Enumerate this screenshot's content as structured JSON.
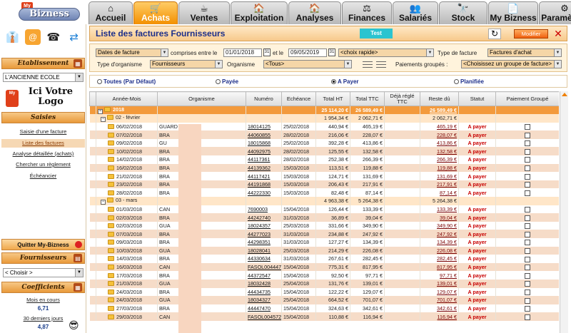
{
  "app": {
    "logo_small": "My",
    "logo": "Bizness"
  },
  "tabs": [
    {
      "label": "Accueil",
      "icon": "⌂"
    },
    {
      "label": "Achats",
      "icon": "🛒"
    },
    {
      "label": "Ventes",
      "icon": "☕"
    },
    {
      "label": "Exploitation",
      "icon": "🏠"
    },
    {
      "label": "Analyses",
      "icon": "🏠"
    },
    {
      "label": "Finances",
      "icon": "⚖"
    },
    {
      "label": "Salariés",
      "icon": "👥"
    },
    {
      "label": "Stock",
      "icon": "🔭"
    },
    {
      "label": "My Bizness",
      "icon": "📄"
    },
    {
      "label": "Paramètres",
      "icon": "⚙"
    }
  ],
  "sidebar": {
    "etablissement_header": "Etablissement",
    "etablissement_value": "L'ANCIENNE ECOLE",
    "logo_tag": "My",
    "logo_text": "Ici Votre Logo",
    "saisies_header": "Saisies",
    "links": [
      "Saisie d'une facture",
      "Liste des factures",
      "Analyse détaillée (achats)",
      "Chercher un règlement",
      "Échéancier"
    ],
    "quit_label": "Quitter My-Bizness",
    "fournisseurs_header": "Fournisseurs",
    "fournisseurs_value": "< Choisir >",
    "coefficients_header": "Coefficients",
    "mois_label": "Mois en cours",
    "mois_value": "6,71",
    "jours_label": "30 derniers jours",
    "jours_value": "4,87"
  },
  "page": {
    "title": "Liste des factures Fournisseurs",
    "test_label": "Test",
    "modifier_label": "Modifier"
  },
  "filters": {
    "date_type": "Dates de facture",
    "between_label": "comprises entre le",
    "date_from": "01/01/2018",
    "and_label": "et le",
    "date_to": "09/05/2019",
    "quick_choice": "<choix rapide>",
    "invoice_type_label": "Type de facture",
    "invoice_type": "Factures d'achat",
    "org_type_label": "Type d'organisme",
    "org_type": "Fournisseurs",
    "org_label": "Organisme",
    "org_value": "<Tous>",
    "grouped_label": "Paiements groupés :",
    "grouped_value": "<Choisissez un groupe de facture>"
  },
  "radios": [
    {
      "label": "Toutes (Par Défaut)",
      "checked": false
    },
    {
      "label": "Payée",
      "checked": false
    },
    {
      "label": "A Payer",
      "checked": true
    },
    {
      "label": "Planifiée",
      "checked": false
    }
  ],
  "table": {
    "headers": [
      "",
      "Année-Mois",
      "Organisme",
      "Numéro",
      "Echéance",
      "Total HT",
      "Total TTC",
      "Déjà réglé TTC",
      "Reste dû",
      "Statut",
      "Paiement Groupé"
    ],
    "year_row": {
      "label": "2018",
      "ht": "25 114,20 €",
      "ttc": "26 589,49 €",
      "reste": "26 589,49 €"
    },
    "rows": [
      {
        "kind": "month",
        "label": "02 - février",
        "ht": "1 954,34 €",
        "ttc": "2 062,71 €",
        "reste": "2 062,71 €"
      },
      {
        "kind": "inv",
        "date": "06/02/2018",
        "org": "GUARD",
        "num": "18014125",
        "due": "25/02/2018",
        "ht": "440,94 €",
        "ttc": "465,19 €",
        "reste": "465,19 €",
        "status": "A payer"
      },
      {
        "kind": "inv",
        "date": "07/02/2018",
        "org": "BRA",
        "num": "44060855",
        "due": "28/02/2018",
        "ht": "216,06 €",
        "ttc": "228,07 €",
        "reste": "228,07 €",
        "status": "A payer"
      },
      {
        "kind": "inv",
        "date": "09/02/2018",
        "org": "GU",
        "num": "18015868",
        "due": "25/02/2018",
        "ht": "392,28 €",
        "ttc": "413,86 €",
        "reste": "413,86 €",
        "status": "A payer"
      },
      {
        "kind": "inv",
        "date": "10/02/2018",
        "org": "BRA",
        "num": "44092975",
        "due": "28/02/2018",
        "ht": "125,55 €",
        "ttc": "132,58 €",
        "reste": "132,58 €",
        "status": "A payer"
      },
      {
        "kind": "inv",
        "date": "14/02/2018",
        "org": "BRA",
        "num": "44117361",
        "due": "28/02/2018",
        "ht": "252,38 €",
        "ttc": "266,39 €",
        "reste": "266,39 €",
        "status": "A payer"
      },
      {
        "kind": "inv",
        "date": "16/02/2018",
        "org": "BRA",
        "num": "44139362",
        "due": "15/03/2018",
        "ht": "113,51 €",
        "ttc": "119,88 €",
        "reste": "119,88 €",
        "status": "A payer"
      },
      {
        "kind": "inv",
        "date": "21/02/2018",
        "org": "BRA",
        "num": "44117421",
        "due": "15/03/2018",
        "ht": "124,71 €",
        "ttc": "131,69 €",
        "reste": "131,69 €",
        "status": "A payer"
      },
      {
        "kind": "inv",
        "date": "23/02/2018",
        "org": "BRA",
        "num": "44191868",
        "due": "15/03/2018",
        "ht": "206,43 €",
        "ttc": "217,91 €",
        "reste": "217,91 €",
        "status": "A payer"
      },
      {
        "kind": "inv",
        "date": "28/02/2018",
        "org": "BRA",
        "num": "44222330",
        "due": "15/03/2018",
        "ht": "82,48 €",
        "ttc": "87,14 €",
        "reste": "87,14 €",
        "status": "A payer"
      },
      {
        "kind": "month",
        "label": "03 - mars",
        "ht": "4 963,38 €",
        "ttc": "5 264,38 €",
        "reste": "5 264,38 €"
      },
      {
        "kind": "inv",
        "date": "01/03/2018",
        "org": "CAN",
        "num": "7690003",
        "due": "15/04/2018",
        "ht": "126,44 €",
        "ttc": "133,39 €",
        "reste": "133,39 €",
        "status": "A payer"
      },
      {
        "kind": "inv",
        "date": "02/03/2018",
        "org": "BRA",
        "num": "44242740",
        "due": "31/03/2018",
        "ht": "36,89 €",
        "ttc": "39,04 €",
        "reste": "39,04 €",
        "status": "A payer"
      },
      {
        "kind": "inv",
        "date": "02/03/2018",
        "org": "GUA",
        "num": "18024357",
        "due": "25/03/2018",
        "ht": "331,66 €",
        "ttc": "349,90 €",
        "reste": "349,90 €",
        "status": "A payer"
      },
      {
        "kind": "inv",
        "date": "07/03/2018",
        "org": "BRA",
        "num": "44277023",
        "due": "31/03/2018",
        "ht": "234,88 €",
        "ttc": "247,92 €",
        "reste": "247,92 €",
        "status": "A payer"
      },
      {
        "kind": "inv",
        "date": "09/03/2018",
        "org": "BRA",
        "num": "44298351",
        "due": "31/03/2018",
        "ht": "127,27 €",
        "ttc": "134,39 €",
        "reste": "134,39 €",
        "status": "A payer"
      },
      {
        "kind": "inv",
        "date": "10/03/2018",
        "org": "GUA",
        "num": "18028041",
        "due": "25/03/2018",
        "ht": "214,29 €",
        "ttc": "226,08 €",
        "reste": "226,08 €",
        "status": "A payer"
      },
      {
        "kind": "inv",
        "date": "14/03/2018",
        "org": "BRA",
        "num": "44330634",
        "due": "31/03/2018",
        "ht": "267,61 €",
        "ttc": "282,45 €",
        "reste": "282,45 €",
        "status": "A payer"
      },
      {
        "kind": "inv",
        "date": "16/03/2018",
        "org": "CAN",
        "num": "FASOL004447",
        "due": "15/04/2018",
        "ht": "775,31 €",
        "ttc": "817,95 €",
        "reste": "817,95 €",
        "status": "A payer"
      },
      {
        "kind": "inv",
        "date": "17/03/2018",
        "org": "BRA",
        "num": "44372547",
        "due": "15/04/2018",
        "ht": "92,50 €",
        "ttc": "97,71 €",
        "reste": "97,71 €",
        "status": "A payer"
      },
      {
        "kind": "inv",
        "date": "21/03/2018",
        "org": "GUA",
        "num": "18032428",
        "due": "25/04/2018",
        "ht": "131,76 €",
        "ttc": "139,01 €",
        "reste": "139,01 €",
        "status": "A payer"
      },
      {
        "kind": "inv",
        "date": "24/03/2018",
        "org": "BRA",
        "num": "44434735",
        "due": "15/04/2018",
        "ht": "122,22 €",
        "ttc": "129,07 €",
        "reste": "129,07 €",
        "status": "A payer"
      },
      {
        "kind": "inv",
        "date": "24/03/2018",
        "org": "GUA",
        "num": "18034327",
        "due": "25/04/2018",
        "ht": "664,52 €",
        "ttc": "701,07 €",
        "reste": "701,07 €",
        "status": "A payer"
      },
      {
        "kind": "inv",
        "date": "27/03/2018",
        "org": "BRA",
        "num": "44447470",
        "due": "15/04/2018",
        "ht": "324,63 €",
        "ttc": "342,61 €",
        "reste": "342,61 €",
        "status": "A payer"
      },
      {
        "kind": "inv",
        "date": "29/03/2018",
        "org": "CAN",
        "num": "FASOL004572",
        "due": "15/04/2018",
        "ht": "110,88 €",
        "ttc": "116,94 €",
        "reste": "116,94 €",
        "status": "A payer"
      }
    ]
  }
}
